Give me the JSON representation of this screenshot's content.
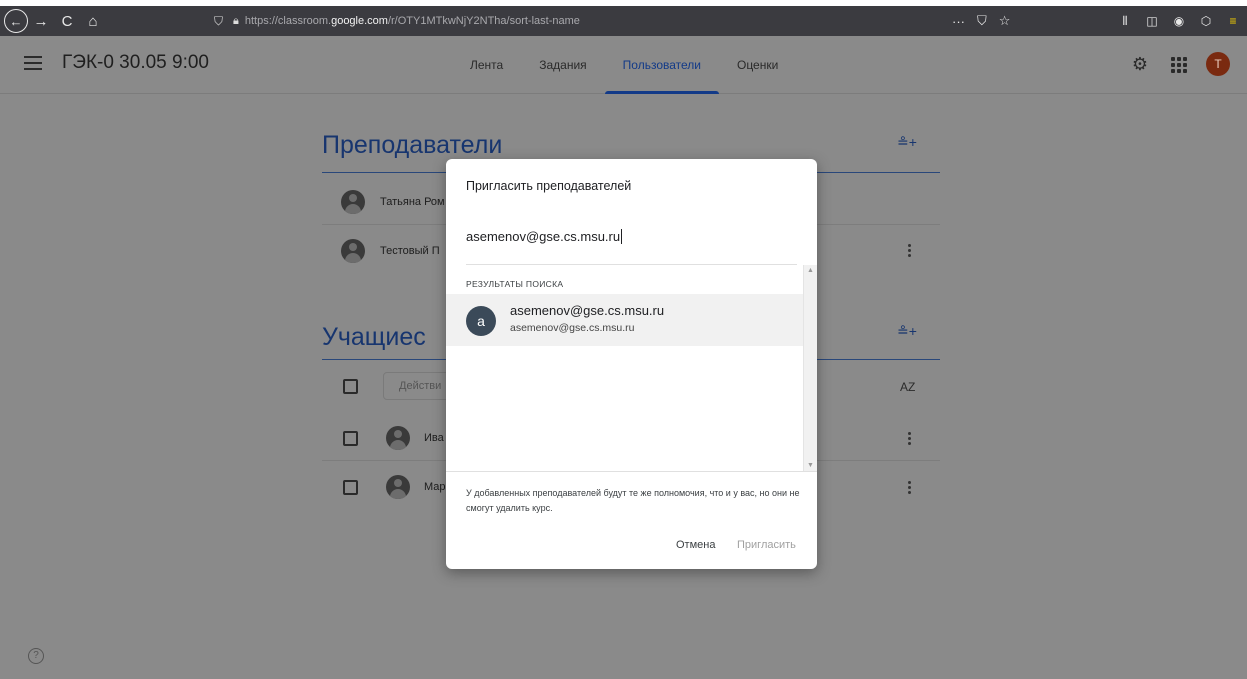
{
  "browser": {
    "back_glyph": "←",
    "forward_glyph": "→",
    "reload_glyph": "C",
    "home_glyph": "⌂",
    "url_prefix": "https://classroom.",
    "url_host": "google.com",
    "url_path": "/r/OTY1MTkwNjY2NTha/sort-last-name",
    "page_actions_glyph": "···",
    "pocket_glyph": "⛉",
    "star_glyph": "☆",
    "library_glyph": "⫴",
    "sidebar_glyph": "◫",
    "account_glyph": "◉",
    "ext_glyph": "⬡",
    "menu_glyph": "≡"
  },
  "header": {
    "course_title": "ГЭК-0 30.05 9:00",
    "tabs": [
      {
        "label": "Лента"
      },
      {
        "label": "Задания"
      },
      {
        "label": "Пользователи"
      },
      {
        "label": "Оценки"
      }
    ],
    "avatar_letter": "T"
  },
  "teachers": {
    "title": "Преподаватели",
    "rows": [
      {
        "name": "Татьяна Ром"
      },
      {
        "name": "Тестовый П"
      }
    ]
  },
  "students": {
    "title": "Учащиес",
    "actions_placeholder": "Действи",
    "rows": [
      {
        "name": "Ива"
      },
      {
        "name": "Мар"
      }
    ],
    "sort_glyph": "AZ"
  },
  "icons": {
    "add_person_glyph": "≗+",
    "help_glyph": "?",
    "gear_glyph": "⚙"
  },
  "dialog": {
    "title": "Пригласить преподавателей",
    "input_value": "asemenov@gse.cs.msu.ru",
    "results_label": "РЕЗУЛЬТАТЫ ПОИСКА",
    "result": {
      "avatar_letter": "a",
      "primary": "asemenov@gse.cs.msu.ru",
      "secondary": "asemenov@gse.cs.msu.ru"
    },
    "footer_note": "У добавленных преподавателей будут те же полномочия, что и у вас, но они не смогут удалить курс.",
    "cancel_label": "Отмена",
    "invite_label": "Пригласить"
  }
}
